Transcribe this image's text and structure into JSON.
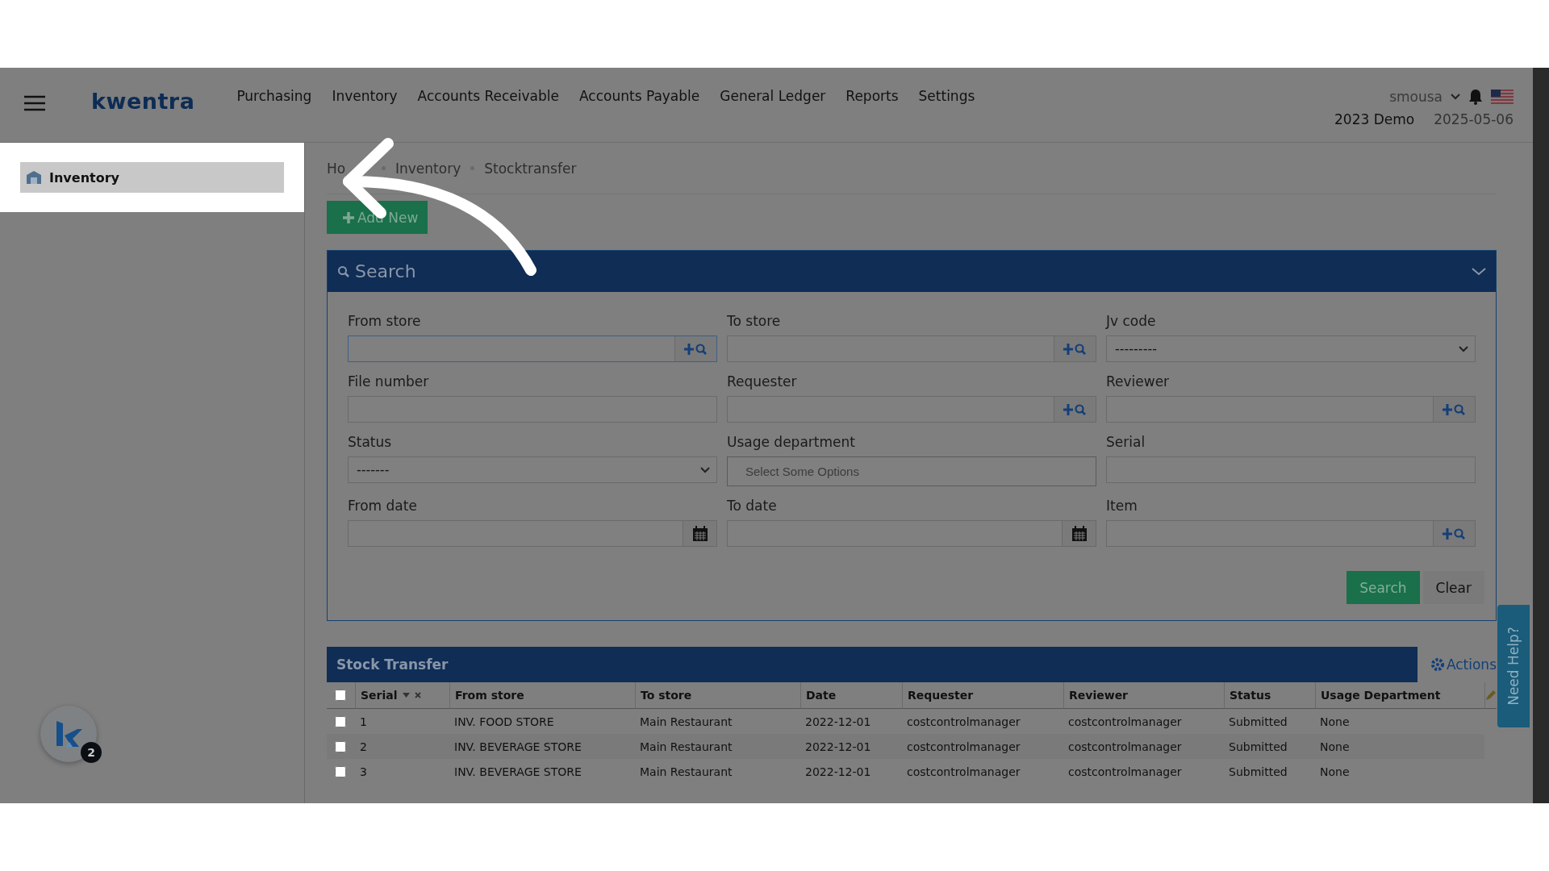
{
  "topbar": {
    "logo": "kwentra",
    "menu": [
      "Purchasing",
      "Inventory",
      "Accounts Receivable",
      "Accounts Payable",
      "General Ledger",
      "Reports",
      "Settings"
    ],
    "user": "smousa",
    "company": "2023 Demo",
    "date": "2025-05-06"
  },
  "sidebar": {
    "items": [
      {
        "label": "Inventory",
        "spotlight": true
      }
    ]
  },
  "breadcrumb": [
    "Ho",
    "Inventory",
    "Stocktransfer"
  ],
  "add_button": "Add New",
  "search_panel": {
    "title": "Search",
    "expanded": true,
    "fields": [
      {
        "label": "From store",
        "kind": "lookup",
        "focused": true
      },
      {
        "label": "To store",
        "kind": "lookup",
        "focused": false
      },
      {
        "label": "Jv code",
        "kind": "select",
        "value": "---------"
      },
      {
        "label": "File number",
        "kind": "text"
      },
      {
        "label": "Requester",
        "kind": "lookup",
        "focused": false
      },
      {
        "label": "Reviewer",
        "kind": "lookup",
        "focused": false
      },
      {
        "label": "Status",
        "kind": "select",
        "value": "-------"
      },
      {
        "label": "Usage department",
        "kind": "multiselect",
        "placeholder": "Select Some Options"
      },
      {
        "label": "Serial",
        "kind": "text"
      },
      {
        "label": "From date",
        "kind": "date"
      },
      {
        "label": "To date",
        "kind": "date"
      },
      {
        "label": "Item",
        "kind": "lookup",
        "focused": false
      }
    ],
    "buttons": [
      {
        "label": "Search",
        "kind": "primary"
      },
      {
        "label": "Clear",
        "kind": "plain"
      }
    ]
  },
  "table": {
    "title": "Stock Transfer",
    "actions": "Actions",
    "all_checked": false,
    "columns": [
      "Serial",
      "From store",
      "To store",
      "Date",
      "Requester",
      "Reviewer",
      "Status",
      "Usage Department"
    ],
    "rows": [
      {
        "checked": false,
        "cells": [
          "1",
          "INV. FOOD STORE",
          "Main Restaurant",
          "2022-12-01",
          "costcontrolmanager",
          "costcontrolmanager",
          "Submitted",
          "None"
        ]
      },
      {
        "checked": false,
        "cells": [
          "2",
          "INV. BEVERAGE STORE",
          "Main Restaurant",
          "2022-12-01",
          "costcontrolmanager",
          "costcontrolmanager",
          "Submitted",
          "None"
        ]
      },
      {
        "checked": false,
        "cells": [
          "3",
          "INV. BEVERAGE STORE",
          "Main Restaurant",
          "2022-12-01",
          "costcontrolmanager",
          "costcontrolmanager",
          "Submitted",
          "None"
        ]
      }
    ]
  },
  "help_tab": "Need Help?",
  "chat_badge": "2"
}
